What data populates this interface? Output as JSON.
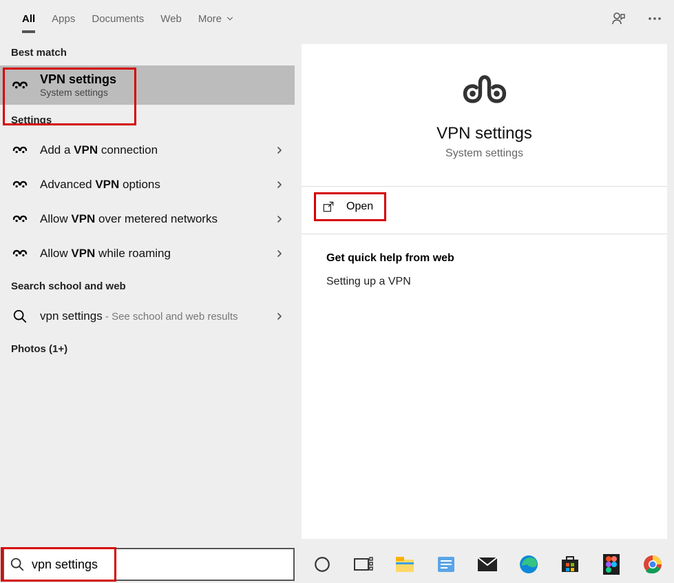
{
  "tabs": {
    "items": [
      "All",
      "Apps",
      "Documents",
      "Web",
      "More"
    ],
    "active": 0
  },
  "sections": {
    "best_match": "Best match",
    "settings": "Settings",
    "search_web": "Search school and web",
    "photos": "Photos (1+)"
  },
  "best": {
    "title": "VPN settings",
    "subtitle": "System settings"
  },
  "settings_items": [
    {
      "pre": "Add a ",
      "bold": "VPN",
      "post": " connection"
    },
    {
      "pre": "Advanced ",
      "bold": "VPN",
      "post": " options"
    },
    {
      "pre": "Allow ",
      "bold": "VPN",
      "post": " over metered networks"
    },
    {
      "pre": "Allow ",
      "bold": "VPN",
      "post": " while roaming"
    }
  ],
  "websearch": {
    "query": "vpn settings",
    "suffix": " - See school and web results"
  },
  "right": {
    "title": "VPN settings",
    "subtitle": "System settings",
    "open": "Open",
    "quick_header": "Get quick help from web",
    "quick_links": [
      "Setting up a VPN"
    ]
  },
  "search": {
    "value": "vpn settings"
  },
  "taskbar_icons": [
    "cortana",
    "taskview",
    "explorer",
    "word",
    "mail",
    "edge",
    "store",
    "figma",
    "chrome"
  ]
}
